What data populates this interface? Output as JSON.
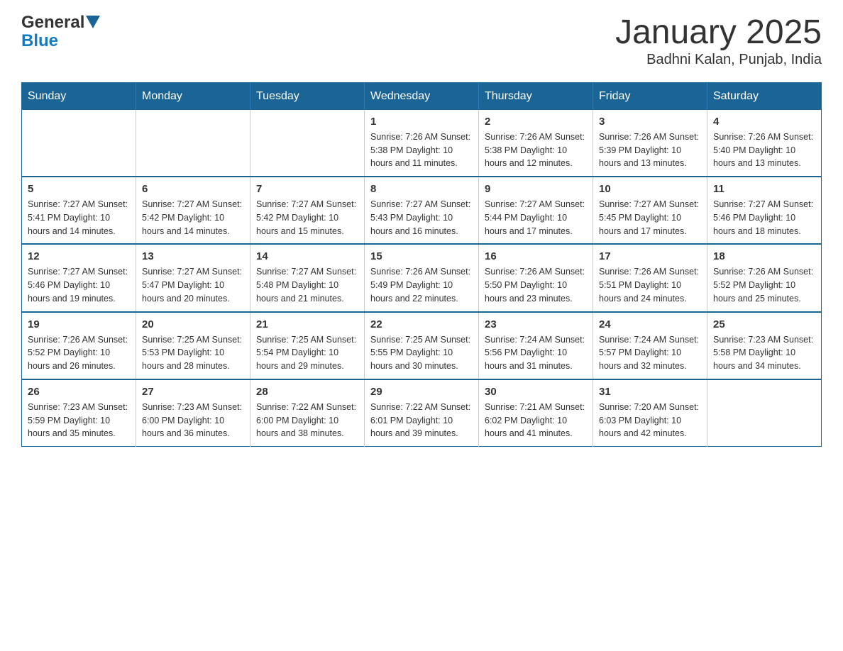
{
  "header": {
    "logo_general": "General",
    "logo_blue": "Blue",
    "title": "January 2025",
    "subtitle": "Badhni Kalan, Punjab, India"
  },
  "calendar": {
    "days_of_week": [
      "Sunday",
      "Monday",
      "Tuesday",
      "Wednesday",
      "Thursday",
      "Friday",
      "Saturday"
    ],
    "weeks": [
      [
        {
          "day": "",
          "info": ""
        },
        {
          "day": "",
          "info": ""
        },
        {
          "day": "",
          "info": ""
        },
        {
          "day": "1",
          "info": "Sunrise: 7:26 AM\nSunset: 5:38 PM\nDaylight: 10 hours\nand 11 minutes."
        },
        {
          "day": "2",
          "info": "Sunrise: 7:26 AM\nSunset: 5:38 PM\nDaylight: 10 hours\nand 12 minutes."
        },
        {
          "day": "3",
          "info": "Sunrise: 7:26 AM\nSunset: 5:39 PM\nDaylight: 10 hours\nand 13 minutes."
        },
        {
          "day": "4",
          "info": "Sunrise: 7:26 AM\nSunset: 5:40 PM\nDaylight: 10 hours\nand 13 minutes."
        }
      ],
      [
        {
          "day": "5",
          "info": "Sunrise: 7:27 AM\nSunset: 5:41 PM\nDaylight: 10 hours\nand 14 minutes."
        },
        {
          "day": "6",
          "info": "Sunrise: 7:27 AM\nSunset: 5:42 PM\nDaylight: 10 hours\nand 14 minutes."
        },
        {
          "day": "7",
          "info": "Sunrise: 7:27 AM\nSunset: 5:42 PM\nDaylight: 10 hours\nand 15 minutes."
        },
        {
          "day": "8",
          "info": "Sunrise: 7:27 AM\nSunset: 5:43 PM\nDaylight: 10 hours\nand 16 minutes."
        },
        {
          "day": "9",
          "info": "Sunrise: 7:27 AM\nSunset: 5:44 PM\nDaylight: 10 hours\nand 17 minutes."
        },
        {
          "day": "10",
          "info": "Sunrise: 7:27 AM\nSunset: 5:45 PM\nDaylight: 10 hours\nand 17 minutes."
        },
        {
          "day": "11",
          "info": "Sunrise: 7:27 AM\nSunset: 5:46 PM\nDaylight: 10 hours\nand 18 minutes."
        }
      ],
      [
        {
          "day": "12",
          "info": "Sunrise: 7:27 AM\nSunset: 5:46 PM\nDaylight: 10 hours\nand 19 minutes."
        },
        {
          "day": "13",
          "info": "Sunrise: 7:27 AM\nSunset: 5:47 PM\nDaylight: 10 hours\nand 20 minutes."
        },
        {
          "day": "14",
          "info": "Sunrise: 7:27 AM\nSunset: 5:48 PM\nDaylight: 10 hours\nand 21 minutes."
        },
        {
          "day": "15",
          "info": "Sunrise: 7:26 AM\nSunset: 5:49 PM\nDaylight: 10 hours\nand 22 minutes."
        },
        {
          "day": "16",
          "info": "Sunrise: 7:26 AM\nSunset: 5:50 PM\nDaylight: 10 hours\nand 23 minutes."
        },
        {
          "day": "17",
          "info": "Sunrise: 7:26 AM\nSunset: 5:51 PM\nDaylight: 10 hours\nand 24 minutes."
        },
        {
          "day": "18",
          "info": "Sunrise: 7:26 AM\nSunset: 5:52 PM\nDaylight: 10 hours\nand 25 minutes."
        }
      ],
      [
        {
          "day": "19",
          "info": "Sunrise: 7:26 AM\nSunset: 5:52 PM\nDaylight: 10 hours\nand 26 minutes."
        },
        {
          "day": "20",
          "info": "Sunrise: 7:25 AM\nSunset: 5:53 PM\nDaylight: 10 hours\nand 28 minutes."
        },
        {
          "day": "21",
          "info": "Sunrise: 7:25 AM\nSunset: 5:54 PM\nDaylight: 10 hours\nand 29 minutes."
        },
        {
          "day": "22",
          "info": "Sunrise: 7:25 AM\nSunset: 5:55 PM\nDaylight: 10 hours\nand 30 minutes."
        },
        {
          "day": "23",
          "info": "Sunrise: 7:24 AM\nSunset: 5:56 PM\nDaylight: 10 hours\nand 31 minutes."
        },
        {
          "day": "24",
          "info": "Sunrise: 7:24 AM\nSunset: 5:57 PM\nDaylight: 10 hours\nand 32 minutes."
        },
        {
          "day": "25",
          "info": "Sunrise: 7:23 AM\nSunset: 5:58 PM\nDaylight: 10 hours\nand 34 minutes."
        }
      ],
      [
        {
          "day": "26",
          "info": "Sunrise: 7:23 AM\nSunset: 5:59 PM\nDaylight: 10 hours\nand 35 minutes."
        },
        {
          "day": "27",
          "info": "Sunrise: 7:23 AM\nSunset: 6:00 PM\nDaylight: 10 hours\nand 36 minutes."
        },
        {
          "day": "28",
          "info": "Sunrise: 7:22 AM\nSunset: 6:00 PM\nDaylight: 10 hours\nand 38 minutes."
        },
        {
          "day": "29",
          "info": "Sunrise: 7:22 AM\nSunset: 6:01 PM\nDaylight: 10 hours\nand 39 minutes."
        },
        {
          "day": "30",
          "info": "Sunrise: 7:21 AM\nSunset: 6:02 PM\nDaylight: 10 hours\nand 41 minutes."
        },
        {
          "day": "31",
          "info": "Sunrise: 7:20 AM\nSunset: 6:03 PM\nDaylight: 10 hours\nand 42 minutes."
        },
        {
          "day": "",
          "info": ""
        }
      ]
    ]
  }
}
